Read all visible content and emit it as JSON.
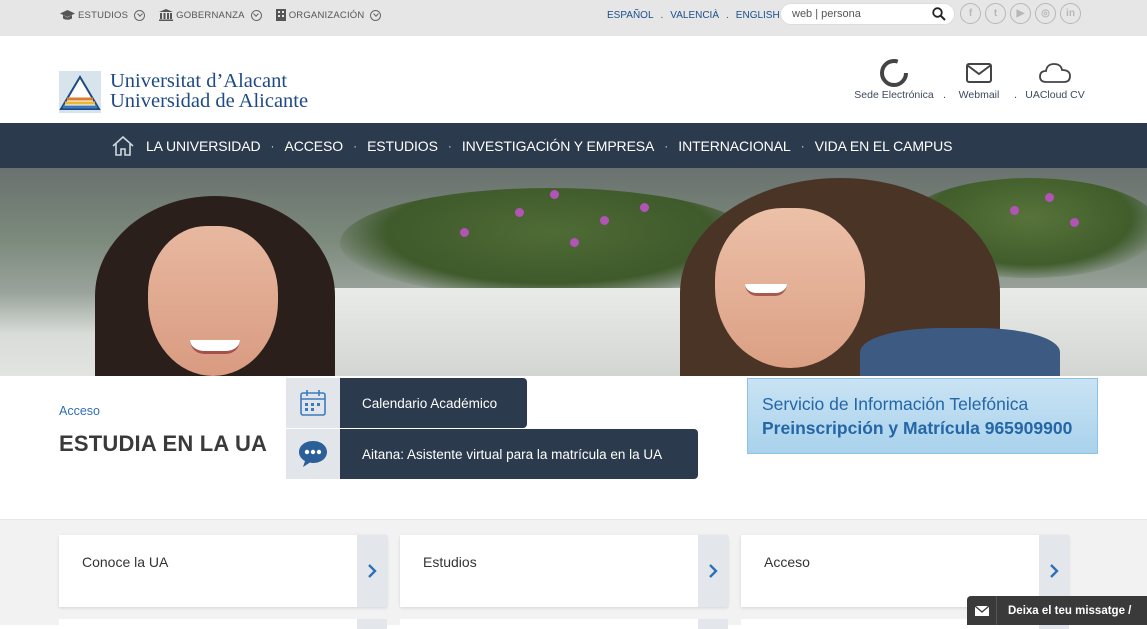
{
  "topbar": {
    "links": [
      {
        "label": "ESTUDIOS"
      },
      {
        "label": "GOBERNANZA"
      },
      {
        "label": "ORGANIZACIÓN"
      }
    ],
    "languages": [
      "ESPAÑOL",
      "VALENCIÀ",
      "ENGLISH"
    ],
    "language_separator": ".",
    "search": {
      "placeholder": "web | persona"
    },
    "social": [
      {
        "icon": "facebook-icon",
        "glyph": "f"
      },
      {
        "icon": "twitter-icon",
        "glyph": "t"
      },
      {
        "icon": "youtube-icon",
        "glyph": "▶"
      },
      {
        "icon": "instagram-icon",
        "glyph": "◎"
      },
      {
        "icon": "linkedin-icon",
        "glyph": "in"
      }
    ]
  },
  "header": {
    "logo_line1": "Universitat d’Alacant",
    "logo_line2": "Universidad de Alicante",
    "tools": [
      {
        "label": "Sede Electrónica",
        "icon": "sede-icon"
      },
      {
        "label": "Webmail",
        "icon": "mail-icon"
      },
      {
        "label": "UACloud CV",
        "icon": "cloud-icon"
      }
    ],
    "tool_separator": "."
  },
  "nav": {
    "items": [
      "LA UNIVERSIDAD",
      "ACCESO",
      "ESTUDIOS",
      "INVESTIGACIÓN Y EMPRESA",
      "INTERNACIONAL",
      "VIDA EN EL CAMPUS"
    ],
    "separator": "·"
  },
  "section": {
    "breadcrumb": "Acceso",
    "title": "ESTUDIA EN LA UA",
    "quick_links": [
      {
        "label": "Calendario Académico",
        "icon": "calendar-icon"
      },
      {
        "label": "Aitana: Asistente virtual para la matrícula en la UA",
        "icon": "chat-bubble-icon"
      }
    ],
    "info": {
      "line1": "Servicio de Información Telefónica",
      "line2": "Preinscripción y Matrícula 965909900"
    }
  },
  "cards": [
    {
      "label": "Conoce la UA"
    },
    {
      "label": "Estudios"
    },
    {
      "label": "Acceso"
    }
  ],
  "chat": {
    "label": "Deixa el teu missatge /"
  },
  "colors": {
    "nav_bg": "#2b3a4c",
    "link_blue": "#2f6fb8",
    "info_bg": "#c9e3f3",
    "topbar_bg": "#e6e6e6"
  }
}
